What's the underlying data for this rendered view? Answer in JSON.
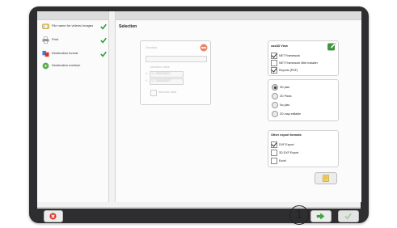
{
  "wizard": {
    "steps": [
      {
        "label": "File name for videos/ images",
        "done": true,
        "icon": "folder-image-icon"
      },
      {
        "label": "Print",
        "done": true,
        "icon": "printer-icon"
      },
      {
        "label": "Destination format",
        "done": true,
        "icon": "format-icon"
      },
      {
        "label": "Destination medium",
        "done": false,
        "icon": "medium-icon"
      }
    ]
  },
  "main": {
    "title": "Selection",
    "left_panel": {
      "header": "Geodata",
      "selection_label": "selection value",
      "x_label": "X",
      "x_value": "1  1.300243527",
      "y_label": "Y",
      "y_value": "1  1.300243527",
      "footer": "Absolute data"
    },
    "view_panel": {
      "header": "cas3D View",
      "options": [
        {
          "label": "NET Framework",
          "checked": true
        },
        {
          "label": "NET Framework Web Installer",
          "checked": false
        },
        {
          "label": "Reports (PDF)",
          "checked": true
        }
      ]
    },
    "plan_panel": {
      "options": [
        {
          "label": "3D plan",
          "selected": true
        },
        {
          "label": "2D Plans",
          "selected": false
        },
        {
          "label": "No plan",
          "selected": false
        },
        {
          "label": "2D map editable",
          "selected": false
        }
      ]
    },
    "export_panel": {
      "header": "Other export formats",
      "options": [
        {
          "label": "DXF Export",
          "checked": true
        },
        {
          "label": "3D DXF Export",
          "checked": false
        },
        {
          "label": "Excel",
          "checked": false
        }
      ]
    }
  },
  "callout": "1",
  "colors": {
    "check": "#2e9e3a",
    "cancel": "#d9342b",
    "next": "#3cae3a"
  }
}
